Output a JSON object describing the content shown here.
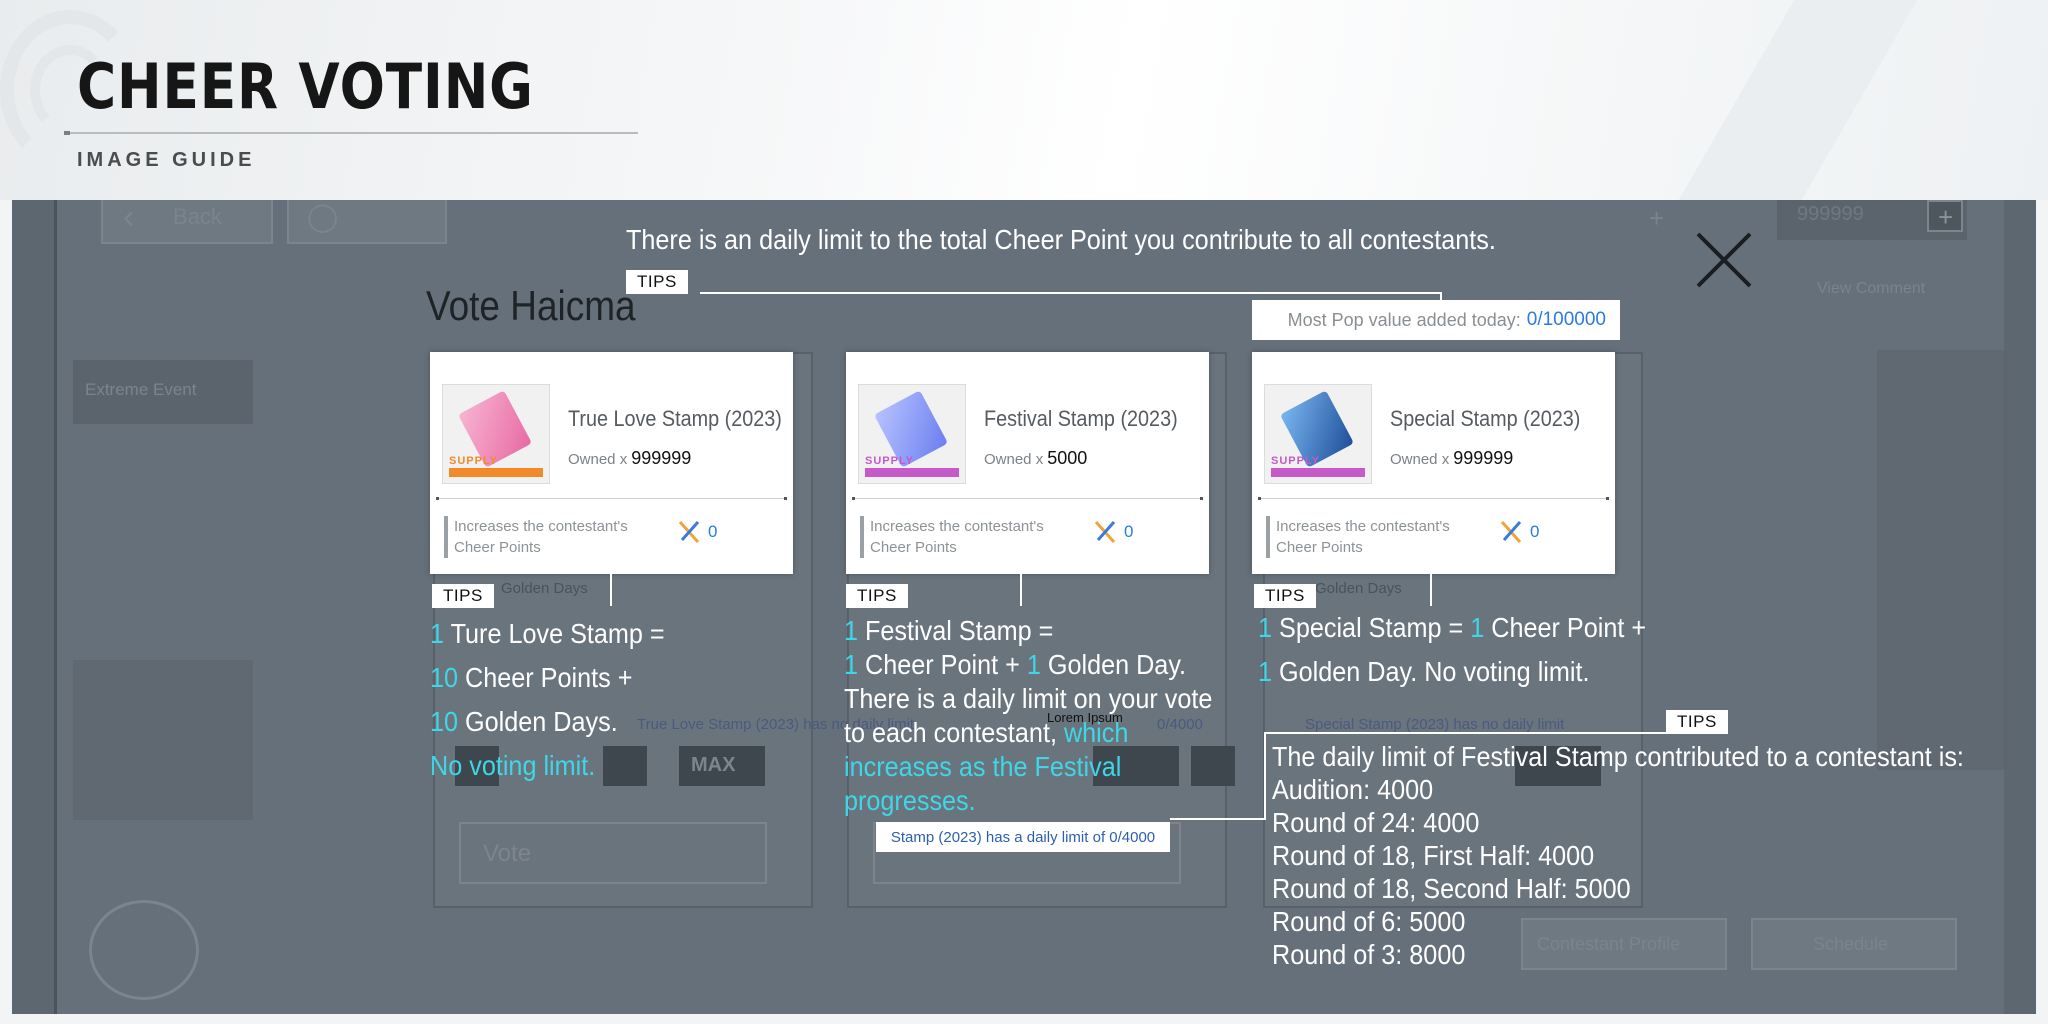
{
  "header": {
    "title": "CHEER VOTING",
    "subtitle": "IMAGE GUIDE"
  },
  "background_ui": {
    "back_label": "Back",
    "lorem_label": "Lorem ipsum",
    "currency_value": "999999",
    "comment_label": "View Comment",
    "event_label": "Extreme Event",
    "contestant_label": "Contestant Profile",
    "schedule_label": "Schedule",
    "vote_button": "Vote",
    "max_button": "MAX",
    "golden_days_label": "Golden Days",
    "no_daily_limit_note": "True Love Stamp (2023) has no daily limit",
    "special_no_limit_note": "Special Stamp (2023) has no daily limit",
    "daily_limit_small": "0/4000",
    "lorem_small": "Lorem Ipsum"
  },
  "overlay": {
    "top_tip": "There is an daily limit to the total Cheer Point you contribute to all contestants.",
    "vote_title": "Vote Haicma",
    "tips_label": "TIPS",
    "most_pop_label": "Most Pop value added today:",
    "most_pop_value": "0/100000",
    "limit_badge": "Stamp (2023) has a daily limit of 0/4000"
  },
  "stamps": [
    {
      "name": "True Love Stamp (2023)",
      "owned_label": "Owned x",
      "owned": "999999",
      "desc": "Increases the contestant's Cheer Points",
      "cheer": "0",
      "supply": "SUPPLY",
      "color": "#e86aa4",
      "bar_color": "#f28a2a"
    },
    {
      "name": "Festival Stamp (2023)",
      "owned_label": "Owned x",
      "owned": "5000",
      "desc": "Increases the contestant's Cheer Points",
      "cheer": "0",
      "supply": "SUPPLY",
      "color": "#6b7ff0",
      "bar_color": "#c65ac9"
    },
    {
      "name": "Special Stamp (2023)",
      "owned_label": "Owned x",
      "owned": "999999",
      "desc": "Increases the contestant's Cheer Points",
      "cheer": "0",
      "supply": "SUPPLY",
      "color": "#3a78c9",
      "bar_color": "#c65ac9"
    }
  ],
  "tips": {
    "love": {
      "l1_num": "1",
      "l1_text": "Ture Love Stamp =",
      "l2_num": "10",
      "l2_text": "Cheer Points +",
      "l3_num": "10",
      "l3_text": "Golden Days.",
      "l4": "No voting limit."
    },
    "festival": {
      "l1_num": "1",
      "l1_text": "Festival Stamp =",
      "l2_num_a": "1",
      "l2_text_a": "Cheer Point +",
      "l2_num_b": "1",
      "l2_text_b": "Golden Day.",
      "l3": "There is a daily limit on your vote",
      "l4_a": "to each contestant,",
      "l4_b": "which",
      "l5": "increases as the Festival",
      "l6": "progresses."
    },
    "special": {
      "l1_num_a": "1",
      "l1_text_a": "Special Stamp =",
      "l1_num_b": "1",
      "l1_text_b": "Cheer Point +",
      "l2_num": "1",
      "l2_text": "Golden Day. No voting limit."
    },
    "schedule": [
      "The daily limit of Festival Stamp contributed to a contestant is:",
      "Audition: 4000",
      "Round of 24: 4000",
      "Round of 18, First Half: 4000",
      "Round of 18, Second Half: 5000",
      "Round of 6: 5000",
      "Round of 3: 8000"
    ]
  },
  "colors": {
    "accent_cyan": "#3fd6e8",
    "link_blue": "#2c7be0",
    "overlay_dim": "#5d6770"
  }
}
